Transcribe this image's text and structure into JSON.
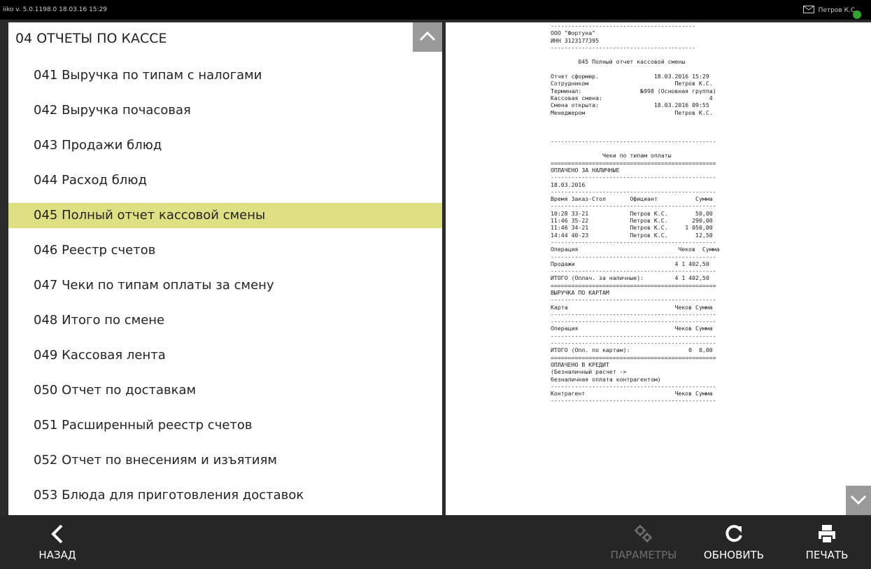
{
  "topbar": {
    "version": "iiko v. 5.0.1198.0   18.03.16  15:29",
    "user": "Петров К.С."
  },
  "left": {
    "section_title": "04 ОТЧЕТЫ ПО КАССЕ",
    "items": [
      "041 Выручка по типам с налогами",
      "042 Выручка почасовая",
      "043 Продажи блюд",
      "044 Расход блюд",
      "045 Полный отчет кассовой смены",
      "046 Реестр счетов",
      "047 Чеки по типам оплаты за смену",
      "048 Итого по смене",
      "049 Кассовая лента",
      "050 Отчет по доставкам",
      "051 Расширенный реестр счетов",
      "052 Отчет по внесениям и изъятиям",
      "053 Блюда для приготовления доставок"
    ],
    "selected_index": 4
  },
  "receipt": {
    "text": "------------------------------------------\nООО \"Фортуна\"\nИНН 3123177395\n------------------------------------------\n\n        045 Полный отчет кассовой смены\n\nОтчет сформир.                18.03.2016 15:29\nСотрудником                         Петров К.С.\nТерминал:                 №998 (Основная группа)\nКассовая смена:                               4\nСмена открыта:                18.03.2016 09:55\nМенеджером                          Петров К.С.\n\n\n\n------------------------------------------------\n\n               Чеки по типам оплаты\n================================================\nОПЛАЧЕНО ЗА НАЛИЧНЫЕ\n------------------------------------------------\n18.03.2016\n------------------------------------------------\nВремя Заказ-Стол       Официант           Сумма\n------------------------------------------------\n10:28 33-21            Петров К.С.        50,00\n11:46 35-22            Петров К.С.       290,00\n11:46 34-21            Петров К.С.     1 050,00\n14:44 40-23            Петров К.С.        12,50\n------------------------------------------------\nОперация                             Чеков  Сумма\n------------------------------------------------\nПродажи                             4 1 402,50\n------------------------------------------------\nИТОГО (Оплач. за наличные):         4 1 402,50\n================================================\nВЫРУЧКА ПО КАРТАМ\n------------------------------------------------\nКарта                               Чеков Сумма\n------------------------------------------------\n------------------------------------------------\nОперация                            Чеков Сумма\n------------------------------------------------\n------------------------------------------------\nИТОГО (Опл. по картам):                 0  0,00\n================================================\nОПЛАЧЕНО В КРЕДИТ\n(Безналичный расчет ->\nбезналичная оплата контрагентом)\n------------------------------------------------\nКонтрагент                          Чеков Сумма\n------------------------------------------------"
  },
  "bottombar": {
    "back_label": "НАЗАД",
    "params_label": "ПАРАМЕТРЫ",
    "refresh_label": "ОБНОВИТЬ",
    "print_label": "ПЕЧАТЬ"
  }
}
